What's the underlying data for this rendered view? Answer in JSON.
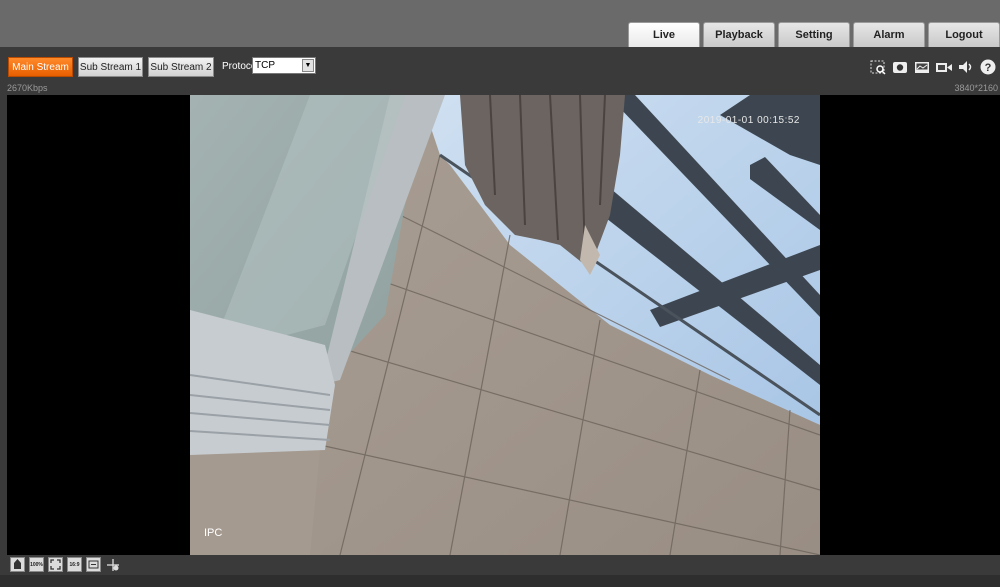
{
  "nav": {
    "tabs": [
      {
        "label": "Live",
        "active": true
      },
      {
        "label": "Playback",
        "active": false
      },
      {
        "label": "Setting",
        "active": false
      },
      {
        "label": "Alarm",
        "active": false
      },
      {
        "label": "Logout",
        "active": false
      }
    ]
  },
  "toolbar": {
    "main_stream": "Main Stream",
    "sub_stream_1": "Sub Stream 1",
    "sub_stream_2": "Sub Stream 2",
    "protocol_label": "Protocol",
    "protocol_value": "TCP",
    "icons": [
      "digital-zoom-icon",
      "snapshot-icon",
      "triple-snapshot-icon",
      "record-icon",
      "audio-icon",
      "help-icon"
    ]
  },
  "info": {
    "bitrate": "2670Kbps",
    "resolution": "3840*2160"
  },
  "video": {
    "osd_time": "2019-01-01 00:15:52",
    "osd_channel": "IPC"
  },
  "bottom_bar": {
    "icons": [
      "original-size-icon",
      "100-percent-icon",
      "fullscreen-icon",
      "aspect-ratio-16-9-icon",
      "fluency-icon",
      "ptz-icon"
    ],
    "labels": [
      "",
      "100%",
      "",
      "16:9",
      "",
      ""
    ]
  },
  "colors": {
    "accent": "#f07514",
    "header": "#6a6a6a",
    "background": "#3a3a3a"
  }
}
